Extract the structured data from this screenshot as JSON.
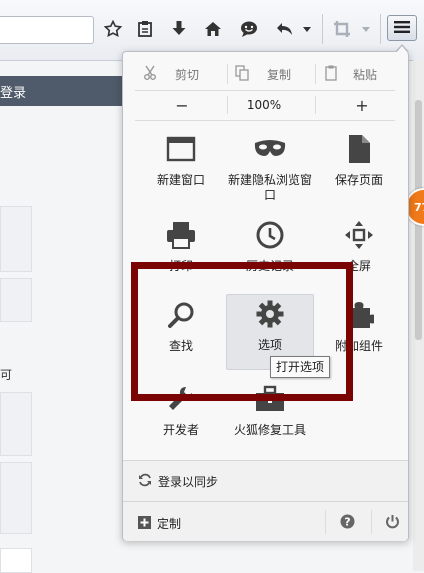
{
  "toolbar": {
    "icons": [
      "star-icon",
      "reading-list-icon",
      "download-icon",
      "home-icon",
      "chat-icon",
      "undo-icon",
      "dropdown-icon",
      "crop-icon",
      "dropdown-icon",
      "hamburger-menu-icon"
    ]
  },
  "left_page": {
    "header_text": "登录",
    "side_text": "可"
  },
  "badge": {
    "text": "77"
  },
  "menu": {
    "edit": {
      "cut": "剪切",
      "copy": "复制",
      "paste": "粘贴"
    },
    "zoom": {
      "minus": "−",
      "value": "100%",
      "plus": "+"
    },
    "items": [
      {
        "label": "新建窗口",
        "icon": "new-window-icon"
      },
      {
        "label": "新建隐私浏览窗口",
        "icon": "private-mask-icon"
      },
      {
        "label": "保存页面",
        "icon": "save-page-icon"
      },
      {
        "label": "打印",
        "icon": "printer-icon"
      },
      {
        "label": "历史记录",
        "icon": "history-clock-icon"
      },
      {
        "label": "全屏",
        "icon": "fullscreen-icon"
      },
      {
        "label": "查找",
        "icon": "search-icon"
      },
      {
        "label": "选项",
        "icon": "gear-icon"
      },
      {
        "label": "附加组件",
        "icon": "puzzle-icon"
      },
      {
        "label": "开发者",
        "icon": "wrench-icon"
      },
      {
        "label": "火狐修复工具",
        "icon": "toolbox-icon"
      }
    ],
    "tooltip": "打开选项",
    "sync_label": "登录以同步",
    "customize_label": "定制"
  },
  "colors": {
    "highlight": "#7a0303",
    "badge": "#f07a1a"
  }
}
